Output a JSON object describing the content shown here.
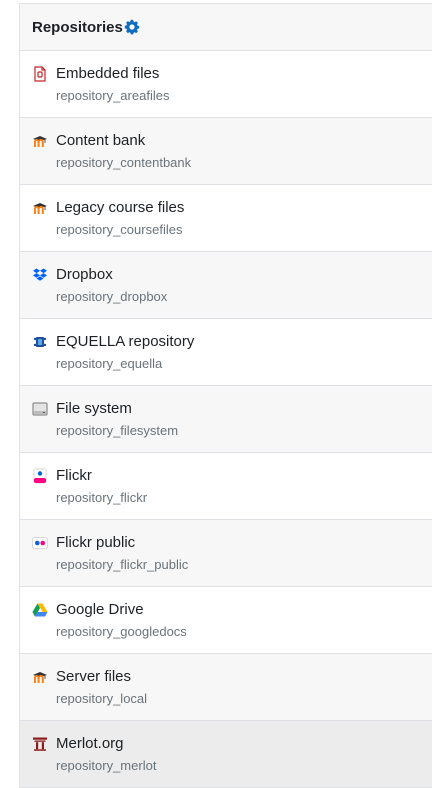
{
  "header": {
    "title": "Repositories",
    "settings_icon": "gear-icon",
    "accent_color": "#0f6cbf"
  },
  "items": [
    {
      "name": "Embedded files",
      "plugin": "repository_areafiles",
      "icon": "embedded-files-icon"
    },
    {
      "name": "Content bank",
      "plugin": "repository_contentbank",
      "icon": "moodle-icon"
    },
    {
      "name": "Legacy course files",
      "plugin": "repository_coursefiles",
      "icon": "moodle-icon"
    },
    {
      "name": "Dropbox",
      "plugin": "repository_dropbox",
      "icon": "dropbox-icon"
    },
    {
      "name": "EQUELLA repository",
      "plugin": "repository_equella",
      "icon": "equella-icon"
    },
    {
      "name": "File system",
      "plugin": "repository_filesystem",
      "icon": "drive-icon"
    },
    {
      "name": "Flickr",
      "plugin": "repository_flickr",
      "icon": "flickr-icon"
    },
    {
      "name": "Flickr public",
      "plugin": "repository_flickr_public",
      "icon": "flickr-public-icon"
    },
    {
      "name": "Google Drive",
      "plugin": "repository_googledocs",
      "icon": "google-drive-icon"
    },
    {
      "name": "Server files",
      "plugin": "repository_local",
      "icon": "moodle-icon"
    },
    {
      "name": "Merlot.org",
      "plugin": "repository_merlot",
      "icon": "merlot-icon"
    }
  ]
}
